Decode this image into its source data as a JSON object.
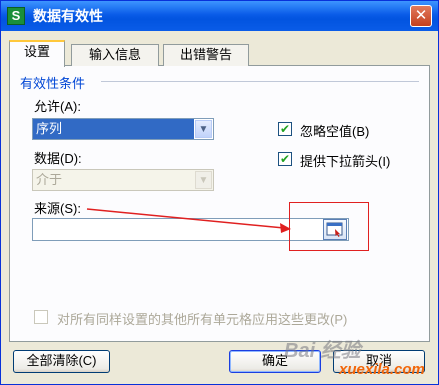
{
  "window": {
    "title": "数据有效性",
    "app_icon": "S",
    "close_glyph": "✕"
  },
  "tabs": [
    {
      "label": "设置",
      "active": true
    },
    {
      "label": "输入信息",
      "active": false
    },
    {
      "label": "出错警告",
      "active": false
    }
  ],
  "section": {
    "title": "有效性条件"
  },
  "allow": {
    "label": "允许(A):",
    "value": "序列",
    "arrow": "▼"
  },
  "data": {
    "label": "数据(D):",
    "value": "介于",
    "arrow": "▼"
  },
  "checks": {
    "ignore_blank": {
      "label": "忽略空值(B)",
      "checked": true,
      "mark": "✔"
    },
    "dropdown": {
      "label": "提供下拉箭头(I)",
      "checked": true,
      "mark": "✔"
    }
  },
  "source": {
    "label": "来源(S):",
    "value": ""
  },
  "apply_all": {
    "label": "对所有同样设置的其他所有单元格应用这些更改(P)",
    "checked": false
  },
  "buttons": {
    "clear_all": "全部清除(C)",
    "ok": "确定",
    "cancel": "取消"
  },
  "watermark": {
    "line1": "Bai 经验",
    "line2": "xuexila.com"
  },
  "colors": {
    "accent": "#316ac5",
    "title_bar": "#0a5ce8",
    "annotation": "#e02020",
    "section_title": "#0046d5"
  }
}
